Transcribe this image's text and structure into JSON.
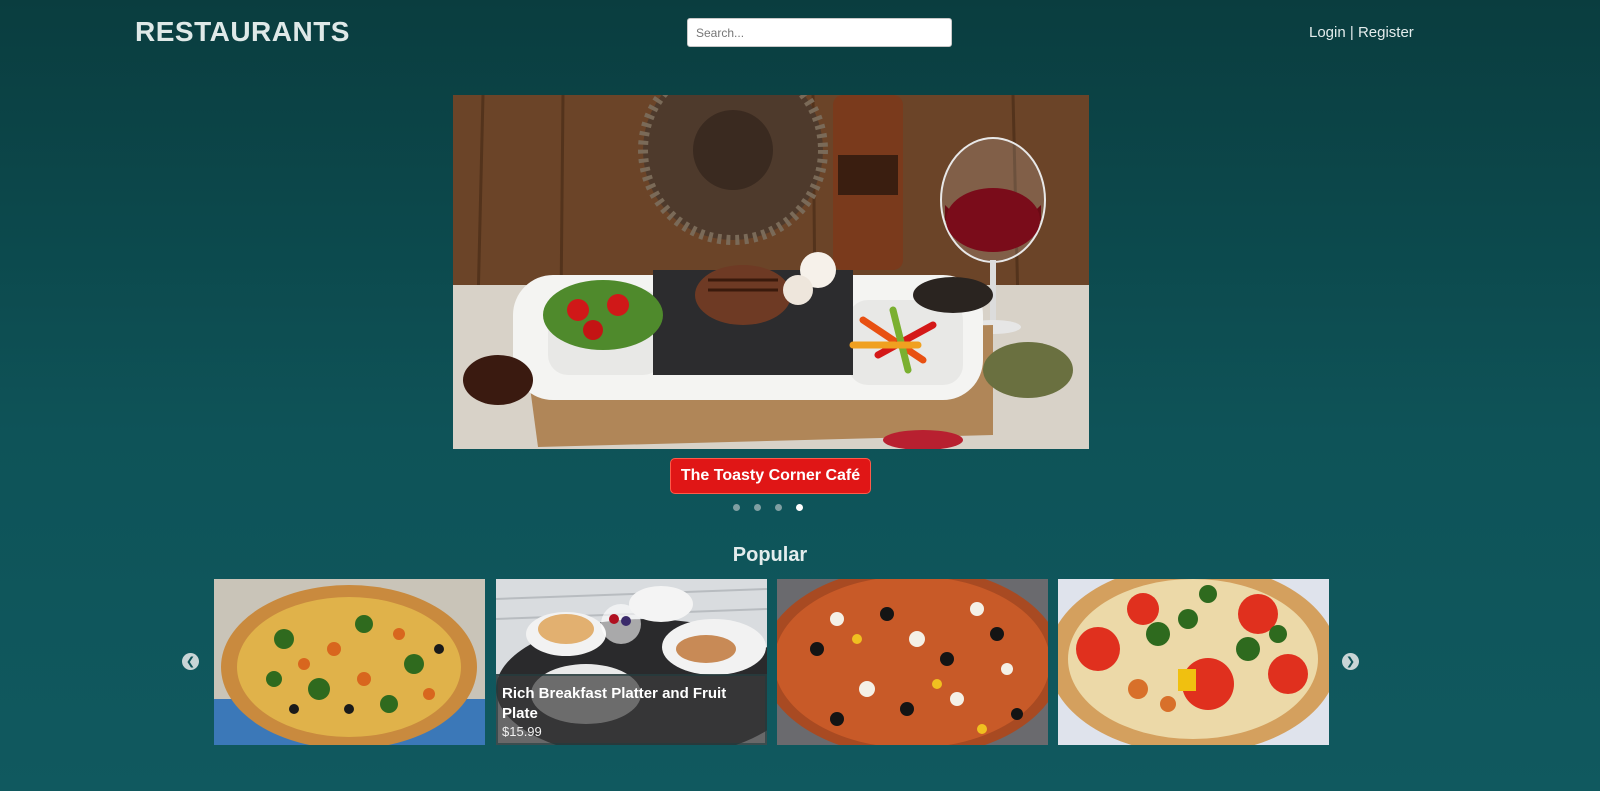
{
  "header": {
    "brand": "RESTAURANTS",
    "search_placeholder": "Search...",
    "login_label": "Login",
    "separator": " | ",
    "register_label": "Register"
  },
  "hero": {
    "caption": "The Toasty Corner Café",
    "slides_total": 4,
    "active_slide": 4
  },
  "popular": {
    "title": "Popular",
    "prev_icon": "chevron-left-icon",
    "next_icon": "chevron-right-icon",
    "items": [
      {
        "image": "pizza-broccoli"
      },
      {
        "image": "breakfast-platter",
        "name": "Rich Breakfast Platter and Fruit Plate",
        "price": "$15.99"
      },
      {
        "image": "pizza-olives"
      },
      {
        "image": "pizza-tomato"
      }
    ]
  },
  "colors": {
    "background_top": "#0a3d3f",
    "background_bottom": "#10595f",
    "caption_red": "#e01616"
  }
}
